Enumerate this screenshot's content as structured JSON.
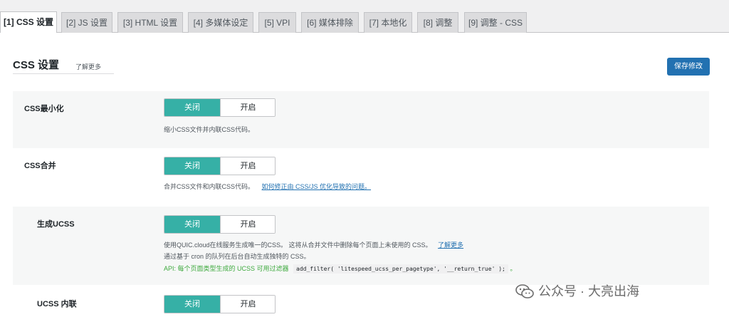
{
  "tabs": [
    {
      "label": "[1] CSS 设置",
      "active": true
    },
    {
      "label": "[2] JS 设置",
      "active": false
    },
    {
      "label": "[3] HTML 设置",
      "active": false
    },
    {
      "label": "[4] 多媒体设定",
      "active": false
    },
    {
      "label": "[5] VPI",
      "active": false
    },
    {
      "label": "[6] 媒体排除",
      "active": false
    },
    {
      "label": "[7] 本地化",
      "active": false
    },
    {
      "label": "[8] 调整",
      "active": false
    },
    {
      "label": "[9] 调整 - CSS",
      "active": false
    }
  ],
  "section": {
    "title": "CSS 设置",
    "learn_more": "了解更多",
    "save_label": "保存修改"
  },
  "settings": [
    {
      "label": "CSS最小化",
      "off": "关闭",
      "on": "开启",
      "desc": "缩小CSS文件并内联CSS代码。"
    },
    {
      "label": "CSS合并",
      "off": "关闭",
      "on": "开启",
      "desc": "合并CSS文件和内联CSS代码。",
      "link": "如何修正由 CSS/JS 优化导致的问题。"
    },
    {
      "label": "生成UCSS",
      "off": "关闭",
      "on": "开启",
      "desc1": "使用QUIC.cloud在线服务生成唯一的CSS。 这将从合并文件中删除每个页面上未使用的 CSS。",
      "desc1_link": "了解更多",
      "desc2": "通过基于 cron 的队列在后台自动生成独特的 CSS。",
      "api_prefix": "API: 每个页面类型生成的 UCSS 可用过滤器",
      "api_code": "add_filter( 'litespeed_ucss_per_pagetype', '__return_true' );",
      "api_suffix": "。"
    },
    {
      "label": "UCSS 内联",
      "off": "关闭",
      "on": "开启"
    }
  ],
  "watermark": {
    "text": "公众号 · 大亮出海",
    "icon": "wechat-icon"
  },
  "colors": {
    "toggle_active": "#36b0a6",
    "save_button": "#2271b1",
    "link": "#2271b1",
    "api_text": "#3eaa3e"
  }
}
